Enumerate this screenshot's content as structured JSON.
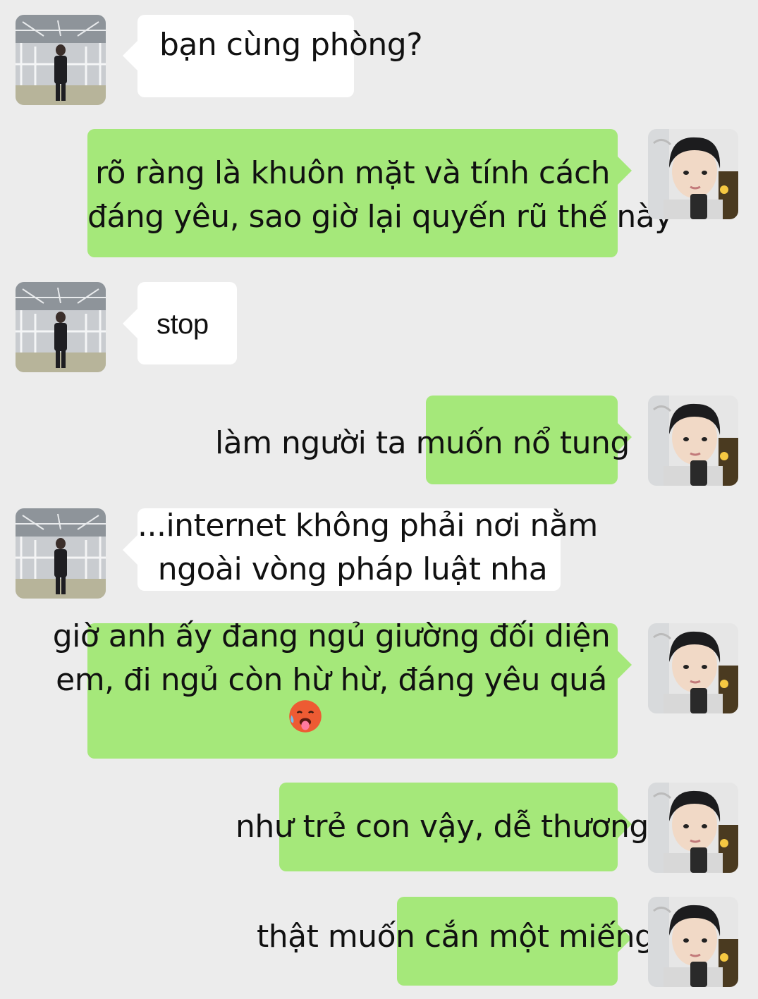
{
  "colors": {
    "background": "#ececec",
    "incoming_bubble": "#ffffff",
    "outgoing_bubble": "#a5e87a"
  },
  "messages": [
    {
      "sender": "other",
      "avatar": "standing-person-avatar",
      "lines": [
        "bạn cùng phòng?"
      ]
    },
    {
      "sender": "self",
      "avatar": "selfie-avatar",
      "lines": [
        "rõ ràng là khuôn mặt và tính cách",
        "đáng yêu, sao giờ lại quyến rũ thế này"
      ]
    },
    {
      "sender": "other",
      "avatar": "standing-person-avatar",
      "lines": [
        "stop"
      ]
    },
    {
      "sender": "self",
      "avatar": "selfie-avatar",
      "lines": [
        "làm người ta muốn nổ tung"
      ]
    },
    {
      "sender": "other",
      "avatar": "standing-person-avatar",
      "lines": [
        "...internet không phải nơi nằm",
        "ngoài vòng pháp luật nha"
      ]
    },
    {
      "sender": "self",
      "avatar": "selfie-avatar",
      "lines": [
        "giờ anh ấy đang ngủ giường đối diện",
        "em, đi ngủ còn hừ hừ, đáng yêu quá"
      ],
      "emoji": "hot-face-emoji"
    },
    {
      "sender": "self",
      "avatar": "selfie-avatar",
      "lines": [
        "như trẻ con vậy, dễ thương"
      ]
    },
    {
      "sender": "self",
      "avatar": "selfie-avatar",
      "lines": [
        "thật muốn cắn một miếng"
      ]
    }
  ]
}
